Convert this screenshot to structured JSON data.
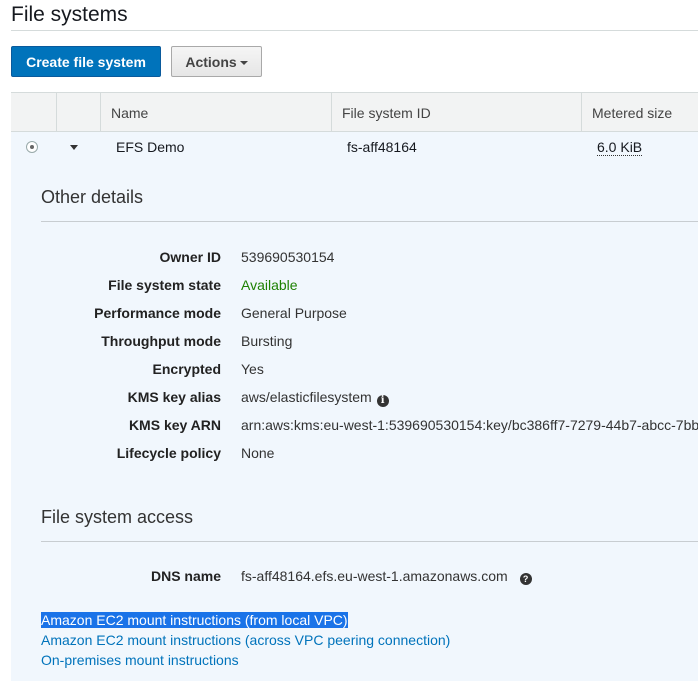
{
  "page": {
    "title": "File systems"
  },
  "toolbar": {
    "create_label": "Create file system",
    "actions_label": "Actions"
  },
  "table": {
    "columns": [
      "",
      "",
      "Name",
      "File system ID",
      "Metered size"
    ],
    "row": {
      "name": "EFS Demo",
      "fs_id": "fs-aff48164",
      "size": "6.0 KiB"
    }
  },
  "other_details": {
    "title": "Other details",
    "fields": [
      {
        "label": "Owner ID",
        "value": "539690530154"
      },
      {
        "label": "File system state",
        "value": "Available"
      },
      {
        "label": "Performance mode",
        "value": "General Purpose"
      },
      {
        "label": "Throughput mode",
        "value": "Bursting"
      },
      {
        "label": "Encrypted",
        "value": "Yes"
      },
      {
        "label": "KMS key alias",
        "value": "aws/elasticfilesystem"
      },
      {
        "label": "KMS key ARN",
        "value": "arn:aws:kms:eu-west-1:539690530154:key/bc386ff7-7279-44b7-abcc-7bb"
      },
      {
        "label": "Lifecycle policy",
        "value": "None"
      }
    ]
  },
  "access": {
    "title": "File system access",
    "dns_label": "DNS name",
    "dns_value": "fs-aff48164.efs.eu-west-1.amazonaws.com",
    "links": [
      "Amazon EC2 mount instructions (from local VPC)",
      "Amazon EC2 mount instructions (across VPC peering connection)",
      "On-premises mount instructions"
    ]
  },
  "colors": {
    "primary": "#0073bb",
    "available": "#1d8102",
    "row_bg": "#f1f7fd"
  },
  "icons": {
    "info": "info-icon",
    "help": "help-icon",
    "expand": "caret-down-icon"
  }
}
